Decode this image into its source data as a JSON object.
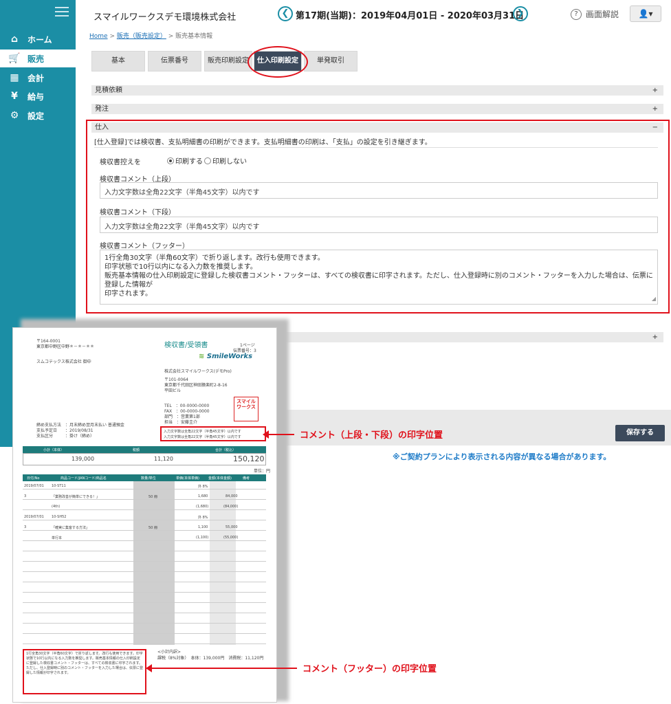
{
  "sidebar": {
    "items": [
      {
        "label": "ホーム",
        "icon": "home-icon",
        "glyph": "⌂"
      },
      {
        "label": "販売",
        "icon": "cart-icon",
        "glyph": "🛒"
      },
      {
        "label": "会計",
        "icon": "calculator-icon",
        "glyph": "▦"
      },
      {
        "label": "給与",
        "icon": "money-bag-icon",
        "glyph": "¥"
      },
      {
        "label": "設定",
        "icon": "gear-icon",
        "glyph": "⚙"
      }
    ]
  },
  "header": {
    "company": "スマイルワークスデモ環境株式会社",
    "period": "第17期(当期)：2019年04月01日 - 2020年03月31日",
    "prev_glyph": "❮",
    "next_glyph": "❯",
    "help_label": "画面解説",
    "user_glyph": "👤▾"
  },
  "breadcrumb": {
    "home": "Home",
    "sep": " > ",
    "sales": "販売（販売設定）",
    "current": "販売基本情報"
  },
  "tabs": [
    "基本",
    "伝票番号",
    "販売印刷設定",
    "仕入印刷設定",
    "単発取引"
  ],
  "sections": {
    "quote": "見積依頼",
    "order": "発注",
    "purchase": "仕入",
    "plus": "+",
    "minus": "−"
  },
  "purchase": {
    "description": "[仕入登録]では検収書、支払明細書の印刷ができます。支払明細書の印刷は、「支払」の設定を引き継ぎます。",
    "receipt_copy_label": "検収書控えを",
    "radio_print": "印刷する",
    "radio_noprint": "印刷しない",
    "upper_label": "検収書コメント（上段）",
    "upper_value": "入力文字数は全角22文字（半角45文字）以内です",
    "lower_label": "検収書コメント（下段）",
    "lower_value": "入力文字数は全角22文字（半角45文字）以内です",
    "footer_label": "検収書コメント（フッター）",
    "footer_lines": [
      "1行全角30文字（半角60文字）で折り返します。改行も使用できます。",
      "印字状態で10行以内になる入力数を推奨します。",
      "販売基本情報の仕入印刷設定に登録した検収書コメント・フッターは、すべての検収書に印字されます。ただし、仕入登録時に別のコメント・フッターを入力した場合は、伝票に登録した情報が",
      "印字されます。"
    ]
  },
  "save_label": "保存する",
  "plan_note": "※ご契約プランにより表示される内容が異なる場合があります。",
  "callouts": {
    "upper_lower": "コメント（上段・下段）の印字位置",
    "footer": "コメント（フッター）の印字位置"
  },
  "doc": {
    "postal": "〒164-0001",
    "address": "東京都中野区中野＊－＊－＊＊",
    "recipient": "スムコテックス株式会社 御中",
    "title": "検収書/受領書",
    "page": "1ページ",
    "slip_no": "伝票番号：3",
    "logo": "SmileWorks",
    "issuer": "株式会社スマイルワークス(デモPro)",
    "issuer_postal": "〒101-0064",
    "issuer_address": "東京都千代田区神田猿楽町2-8-16",
    "issuer_bldg": "平田ビル",
    "tel": "TEL　：00-0000-0000",
    "fax": "FAX　：00-0000-0000",
    "dept": "部門　：営業第1部",
    "staff": "担当　：安藤圭介",
    "stamp": "スマイルワークス",
    "terms1": "締め支払方法　：月末締め翌月末払い 普通預金",
    "terms2": "支払予定日　　：2019/08/31",
    "terms3": "支払区分　　　：掛け（締め）",
    "comment_upper": "入力文字数は全角22文字（半角45文字）以内です",
    "comment_lower": "入力文字数は全角22文字（半角45文字）以内です",
    "sum_headers": [
      "小計（本体）",
      "税額",
      "合計（税込）"
    ],
    "sum_values": [
      "139,000",
      "11,120",
      "150,120"
    ],
    "unit": "単位：円",
    "table_headers": [
      "日付/No",
      "商品コード/JANコード/商品名",
      "数量/単位",
      "単価(本体単価)",
      "金額(本体金額)",
      "備考"
    ],
    "rows": [
      [
        "2019/07/01",
        "10-ST11",
        "",
        "外 8%",
        "",
        ""
      ],
      [
        "3",
        "「業務改善が簡単にできる！」",
        "50 冊",
        "1,680",
        "84,000",
        ""
      ],
      [
        "",
        "(4th)",
        "",
        "(1,680)",
        "(84,000)",
        ""
      ],
      [
        "2019/07/01",
        "10-SH52",
        "",
        "外 8%",
        "",
        ""
      ],
      [
        "3",
        "「確実に集客する方法」",
        "50 冊",
        "1,100",
        "55,000",
        ""
      ],
      [
        "",
        "単行本",
        "",
        "(1,100)",
        "(55,000)",
        ""
      ]
    ],
    "footer_text": "1行全角30文字（半角60文字）で折り返します。改行も使用できます。印字状態で10行以内になる入力数を推奨します。販売基本情報の仕入印刷設定に登録した検収書コメント・フッターは、すべての検収書に印字されます。ただし、仕入登録時に別のコメント・フッターを入力した場合は、伝票に登録した情報が印字されます。",
    "tax_summary": "<小計内訳>",
    "tax_line": "課税（8%対象）　本体：139,000円　消費税：11,120円"
  }
}
